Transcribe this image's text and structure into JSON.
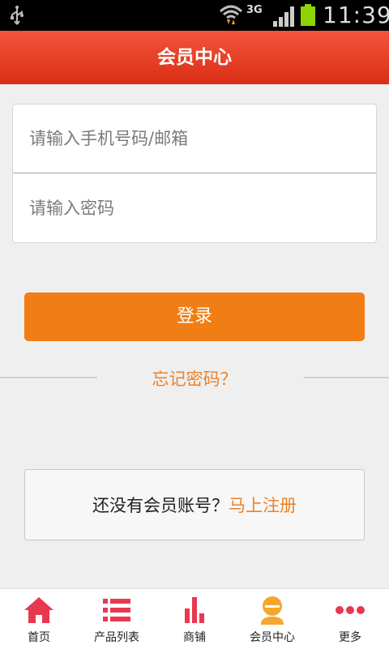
{
  "status_bar": {
    "network_label": "3G",
    "time": "11:39"
  },
  "header": {
    "title": "会员中心"
  },
  "login_form": {
    "account_placeholder": "请输入手机号码/邮箱",
    "password_placeholder": "请输入密码",
    "login_button": "登录",
    "forgot_password": "忘记密码？"
  },
  "register": {
    "prompt": "还没有会员账号？",
    "link": "马上注册"
  },
  "bottom_nav": {
    "items": [
      {
        "label": "首页",
        "icon": "home-icon"
      },
      {
        "label": "产品列表",
        "icon": "list-icon"
      },
      {
        "label": "商铺",
        "icon": "bar-chart-icon"
      },
      {
        "label": "会员中心",
        "icon": "member-icon",
        "active": true
      },
      {
        "label": "更多",
        "icon": "more-dots-icon"
      }
    ]
  },
  "colors": {
    "header": "#e83a20",
    "accent_orange": "#f07e14",
    "nav_icon_red": "#e8384f",
    "active_icon": "#f3a72c"
  }
}
